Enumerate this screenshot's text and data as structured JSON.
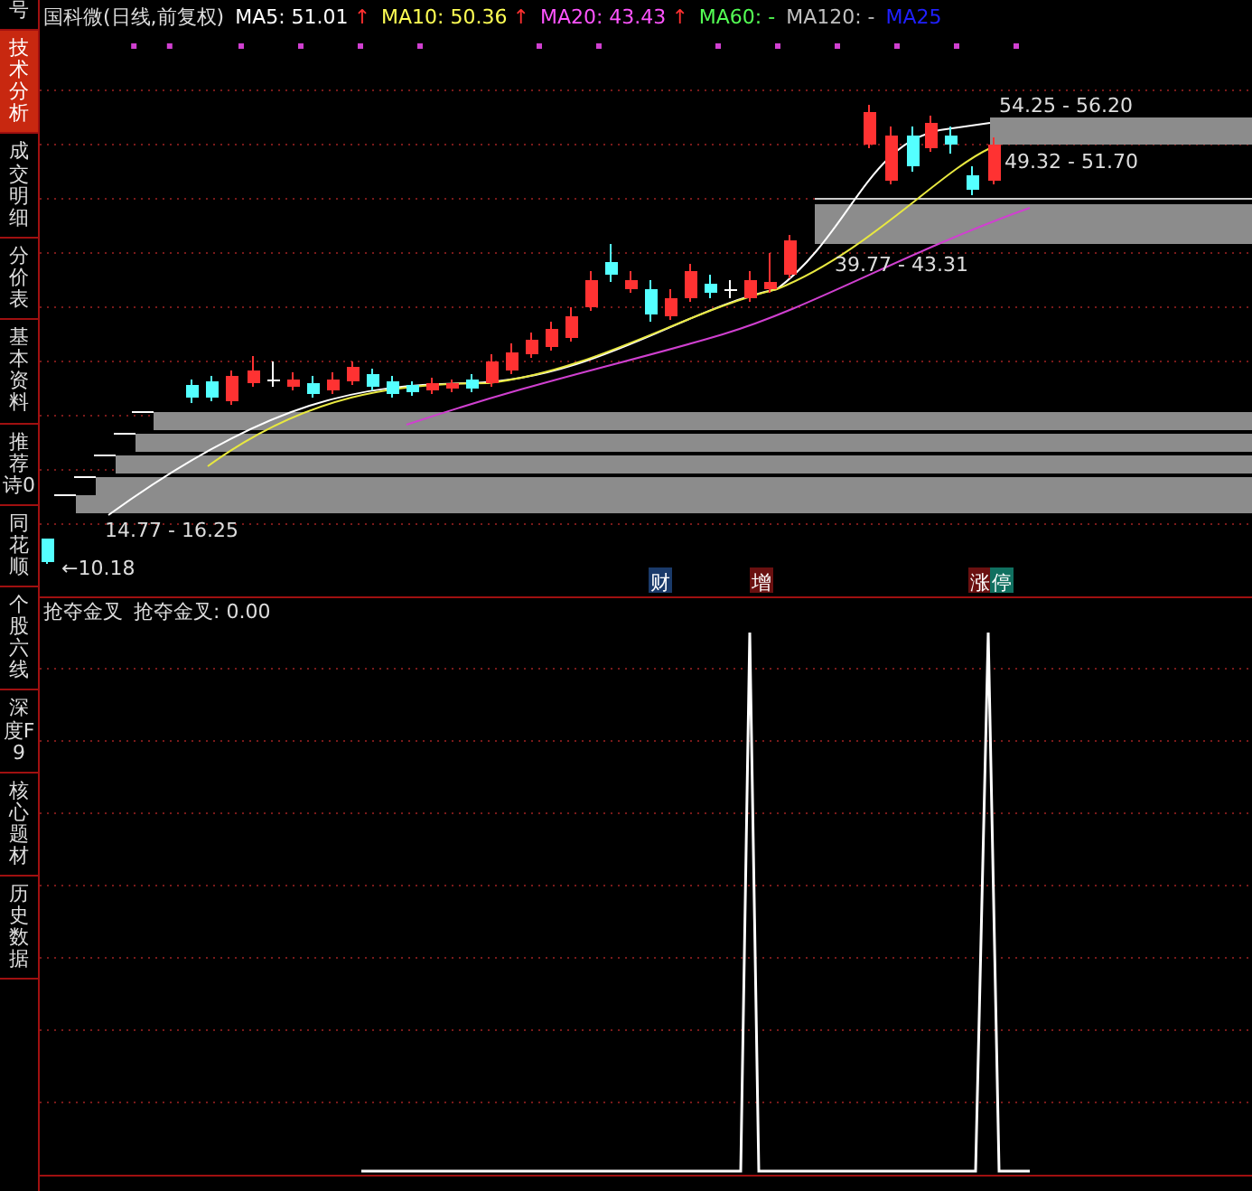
{
  "side_tabs": [
    {
      "label": "号",
      "selected": false
    },
    {
      "label": "技术分析",
      "selected": true
    },
    {
      "label": "成交明细",
      "selected": false
    },
    {
      "label": "分价表",
      "selected": false
    },
    {
      "label": "基本资料",
      "selected": false
    },
    {
      "label": "推荐诗0",
      "selected": false
    },
    {
      "label": "同花顺",
      "selected": false
    },
    {
      "label": "个股六线",
      "selected": false
    },
    {
      "label": "深度F9",
      "selected": false
    },
    {
      "label": "核心题材",
      "selected": false
    },
    {
      "label": "历史数据",
      "selected": false
    }
  ],
  "header": {
    "title": "国科微(日线,前复权)",
    "averages": [
      {
        "label": "MA5: 51.01",
        "color": "#ffffff",
        "arrow": "↑"
      },
      {
        "label": "MA10: 50.36",
        "color": "#ffff54",
        "arrow": "↑"
      },
      {
        "label": "MA20: 43.43",
        "color": "#ff54ff",
        "arrow": "↑"
      },
      {
        "label": "MA60: -",
        "color": "#54ff54"
      },
      {
        "label": "MA120: -",
        "color": "#c0c0c0"
      },
      {
        "label": "MA25",
        "color": "#2020ff"
      }
    ]
  },
  "price_zones": [
    {
      "label": "54.25 - 56.20"
    },
    {
      "label": "49.32 - 51.70"
    },
    {
      "label": "39.77 - 43.31"
    },
    {
      "label": "14.77 - 16.25"
    }
  ],
  "low_label": "←10.18",
  "event_markers": [
    {
      "text": "财",
      "color": "#1a3a6a"
    },
    {
      "text": "增",
      "color": "#6a1010"
    },
    {
      "text": "涨",
      "color": "#6a1010"
    },
    {
      "text": "停",
      "color": "#107060"
    }
  ],
  "indicator": {
    "name": "抢夺金叉",
    "reading": "抢夺金叉: 0.00"
  }
}
